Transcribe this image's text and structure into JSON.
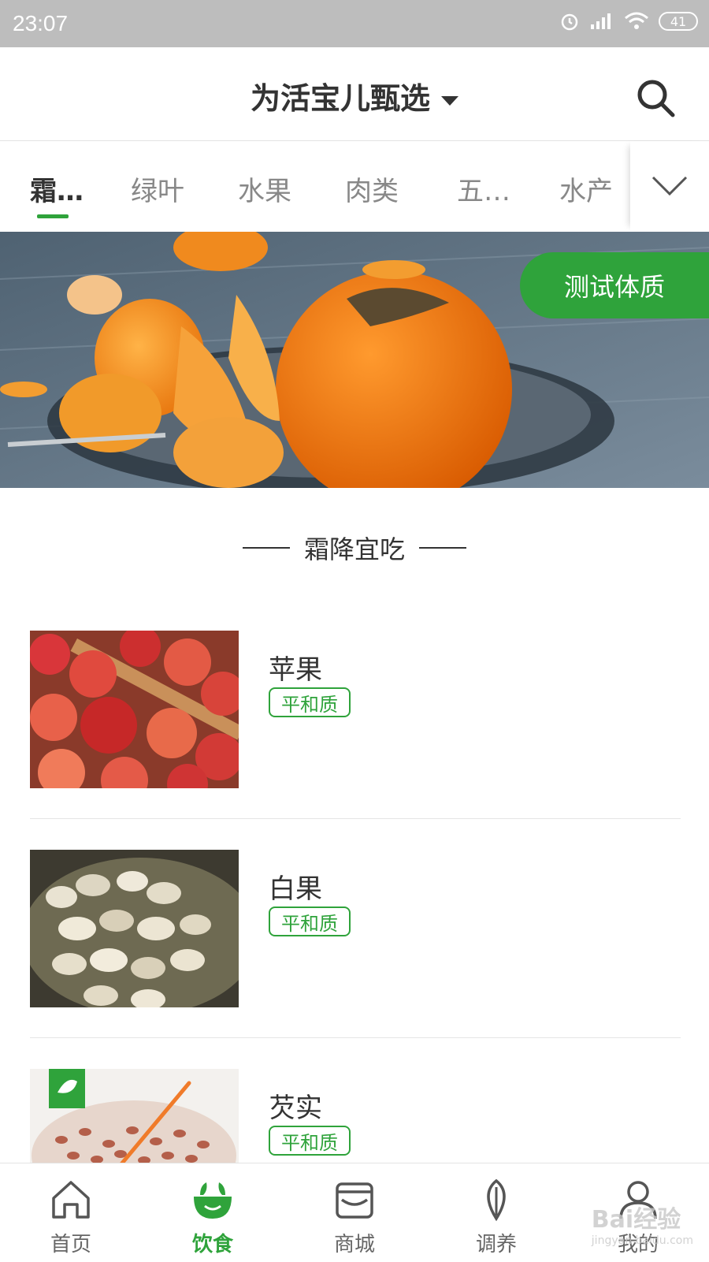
{
  "status_bar": {
    "time": "23:07",
    "battery": "41"
  },
  "header": {
    "title": "为活宝儿甄选"
  },
  "tabs": [
    {
      "label": "霜…"
    },
    {
      "label": "绿叶"
    },
    {
      "label": "水果"
    },
    {
      "label": "肉类"
    },
    {
      "label": "五…"
    },
    {
      "label": "水产"
    }
  ],
  "banner": {
    "button_label": "测试体质"
  },
  "section": {
    "title": "霜降宜吃"
  },
  "items": [
    {
      "name": "苹果",
      "tag": "平和质"
    },
    {
      "name": "白果",
      "tag": "平和质"
    },
    {
      "name": "芡实",
      "tag": "平和质"
    }
  ],
  "bottom_nav": [
    {
      "label": "首页",
      "icon": "home-icon"
    },
    {
      "label": "饮食",
      "icon": "bowl-icon"
    },
    {
      "label": "商城",
      "icon": "store-icon"
    },
    {
      "label": "调养",
      "icon": "leaf-icon"
    },
    {
      "label": "我的",
      "icon": "person-icon"
    }
  ],
  "watermark": {
    "text": "Bai经验",
    "sub": "jingyan.baidu.com"
  },
  "colors": {
    "accent": "#2fa33b",
    "status_bar": "#bdbdbd"
  }
}
